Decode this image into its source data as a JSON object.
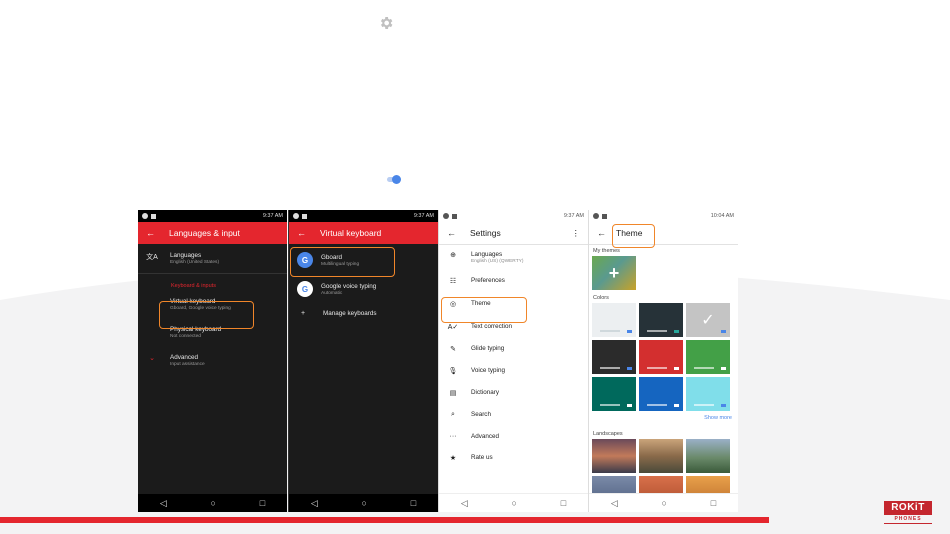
{
  "panels": [
    {
      "status_time": "9:37 AM",
      "appbar_title": "Languages & input",
      "items": [
        {
          "title": "Languages",
          "subtitle": "English (United States)"
        },
        {
          "section": "Keyboard & inputs"
        },
        {
          "title": "Virtual keyboard",
          "subtitle": "Gboard, Google voice typing"
        },
        {
          "title": "Physical keyboard",
          "subtitle": "Not connected"
        },
        {
          "title": "Advanced",
          "subtitle": "Input assistance"
        }
      ]
    },
    {
      "status_time": "9:37 AM",
      "appbar_title": "Virtual keyboard",
      "items": [
        {
          "title": "Gboard",
          "subtitle": "Multilingual typing"
        },
        {
          "title": "Google voice typing",
          "subtitle": "Automatic"
        },
        {
          "title": "Manage keyboards"
        }
      ]
    },
    {
      "status_time": "9:37 AM",
      "appbar_title": "Settings",
      "items": [
        {
          "title": "Languages",
          "subtitle": "English (US) (QWERTY)"
        },
        {
          "title": "Preferences"
        },
        {
          "title": "Theme"
        },
        {
          "title": "Text correction"
        },
        {
          "title": "Glide typing"
        },
        {
          "title": "Voice typing"
        },
        {
          "title": "Dictionary"
        },
        {
          "title": "Search"
        },
        {
          "title": "Advanced"
        },
        {
          "title": "Rate us"
        }
      ]
    },
    {
      "status_time": "10:04 AM",
      "appbar_title": "Theme",
      "my_themes_label": "My themes",
      "colors_label": "Colors",
      "show_more": "Show more",
      "landscapes_label": "Landscapes"
    }
  ],
  "colors": {
    "accent_red": "#e4262e",
    "highlight_orange": "#f0862a",
    "swatches": [
      "#eceff1",
      "#263238",
      "#c4c4c4",
      "#2b2b2b",
      "#d32f2f",
      "#43a047",
      "#00695c",
      "#1565c0",
      "#80deea"
    ]
  },
  "icons": {
    "translate": "文A",
    "plus": "+",
    "check": "✓",
    "back": "←",
    "menu": "⋮",
    "nav_back": "◁",
    "nav_home": "○",
    "nav_recent": "□",
    "globe": "⊕",
    "sliders": "☷",
    "palette": "◎",
    "text_correction": "A✓",
    "glide": "✎",
    "mic": "🎙",
    "book": "▤",
    "search": "⌕",
    "dots": "···",
    "star": "★",
    "chevron": "⌄"
  },
  "logo": {
    "main": "ROKiT",
    "sub": "PHONES"
  }
}
